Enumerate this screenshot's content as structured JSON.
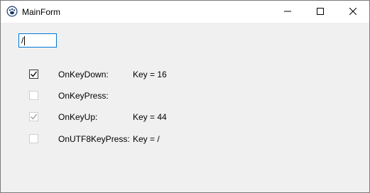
{
  "window": {
    "title": "MainForm",
    "controls": {
      "minimize": "minimize",
      "maximize": "maximize",
      "close": "close"
    }
  },
  "edit": {
    "value": "/"
  },
  "events": [
    {
      "label": "OnKeyDown:",
      "value": "Key = 16",
      "checked": true,
      "enabled": true
    },
    {
      "label": "OnKeyPress:",
      "value": "",
      "checked": false,
      "enabled": false
    },
    {
      "label": "OnKeyUp:",
      "value": "Key = 44",
      "checked": true,
      "enabled": false
    },
    {
      "label": "OnUTF8KeyPress:",
      "value": "Key = /",
      "checked": false,
      "enabled": false
    }
  ],
  "icons": {
    "app": "paw-icon",
    "check": "checkmark-icon"
  }
}
